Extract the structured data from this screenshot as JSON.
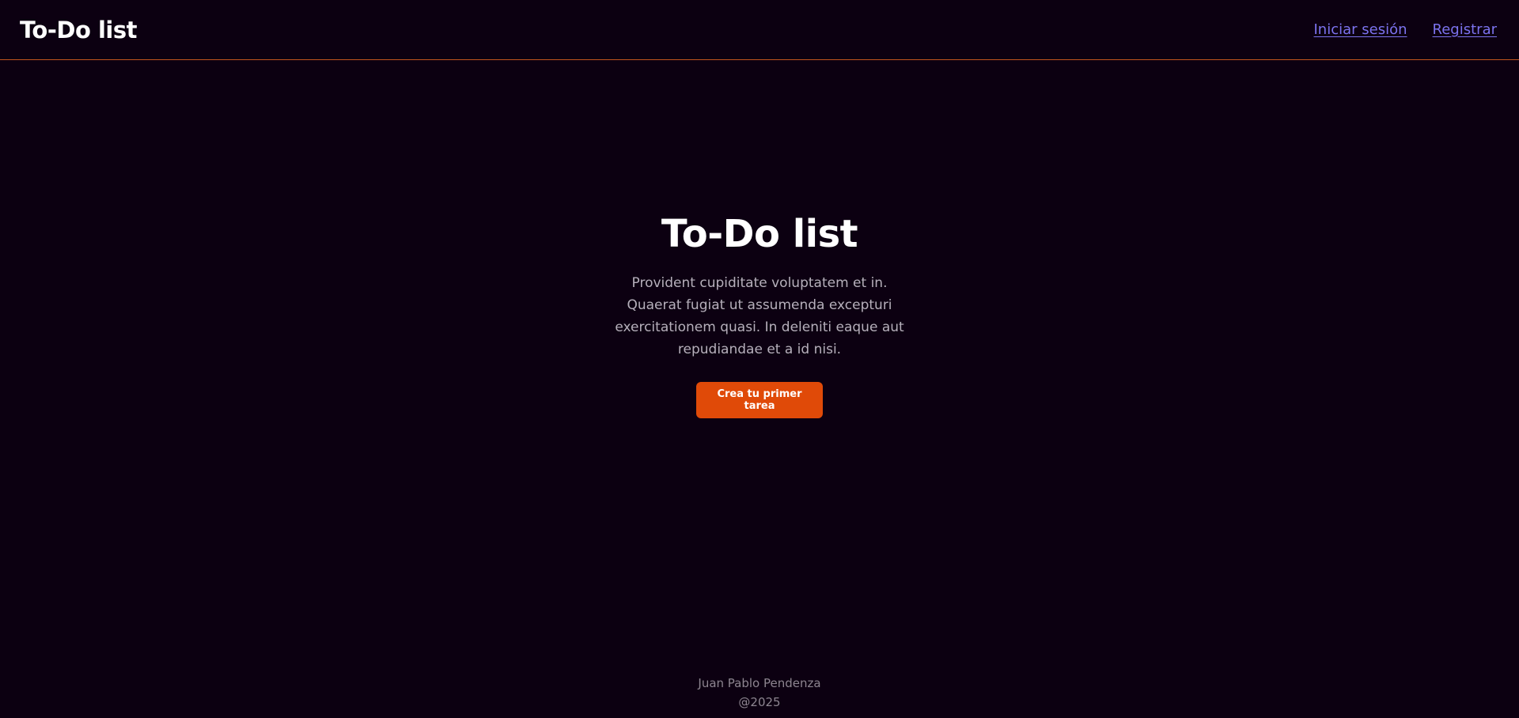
{
  "header": {
    "brand": "To-Do list",
    "links": [
      {
        "label": "Iniciar sesión"
      },
      {
        "label": "Registrar"
      }
    ]
  },
  "hero": {
    "title": "To-Do list",
    "description": "Provident cupiditate voluptatem et in. Quaerat fugiat ut assumenda excepturi exercitationem quasi. In deleniti eaque aut repudiandae et a id nisi.",
    "cta_label": "Crea tu primer tarea"
  },
  "footer": {
    "author": "Juan Pablo Pendenza",
    "copyright": "@2025"
  },
  "colors": {
    "background": "#0c0011",
    "accent": "#e04a08",
    "nav_border": "#c2541e",
    "link": "#7c73ee",
    "body_text": "#b6b0bb",
    "footer_text": "#8d8590"
  }
}
